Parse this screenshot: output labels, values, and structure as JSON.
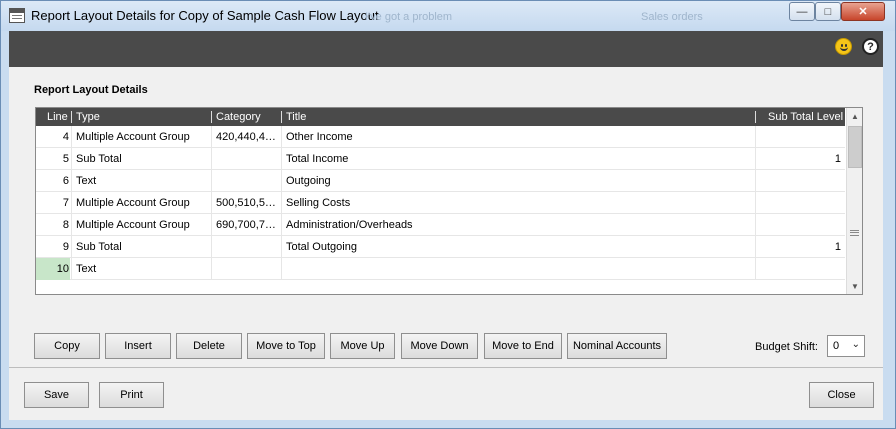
{
  "window": {
    "title": "Report Layout Details for Copy of Sample Cash Flow Layout",
    "ghost_texts": [
      "I've got a problem",
      "Sales orders"
    ],
    "controls": {
      "minimize": "—",
      "maximize": "□",
      "close": "✕"
    }
  },
  "toolbar": {
    "smiley_icon": "smiley-icon",
    "help_icon": "?"
  },
  "section": {
    "title": "Report Layout Details"
  },
  "table": {
    "columns": [
      "Line",
      "Type",
      "Category",
      "Title",
      "Sub Total Level"
    ],
    "rows": [
      {
        "line": "4",
        "type": "Multiple Account Group",
        "category": "420,440,4…",
        "title": "Other Income",
        "sub_total_level": ""
      },
      {
        "line": "5",
        "type": "Sub Total",
        "category": "",
        "title": "Total Income",
        "sub_total_level": "1"
      },
      {
        "line": "6",
        "type": "Text",
        "category": "",
        "title": "Outgoing",
        "sub_total_level": ""
      },
      {
        "line": "7",
        "type": "Multiple Account Group",
        "category": "500,510,5…",
        "title": "Selling Costs",
        "sub_total_level": ""
      },
      {
        "line": "8",
        "type": "Multiple Account Group",
        "category": "690,700,7…",
        "title": "Administration/Overheads",
        "sub_total_level": ""
      },
      {
        "line": "9",
        "type": "Sub Total",
        "category": "",
        "title": "Total Outgoing",
        "sub_total_level": "1"
      },
      {
        "line": "10",
        "type": "Text",
        "category": "",
        "title": "",
        "sub_total_level": ""
      }
    ]
  },
  "actions": {
    "copy": "Copy",
    "insert": "Insert",
    "delete": "Delete",
    "move_to_top": "Move to Top",
    "move_up": "Move Up",
    "move_down": "Move Down",
    "move_to_end": "Move to End",
    "nominal_accounts": "Nominal Accounts"
  },
  "budget_shift": {
    "label": "Budget Shift:",
    "value": "0"
  },
  "footer": {
    "save": "Save",
    "print": "Print",
    "close": "Close"
  },
  "colors": {
    "selected_line": "#c8e6c9",
    "header_bg": "#4a4a4a"
  }
}
